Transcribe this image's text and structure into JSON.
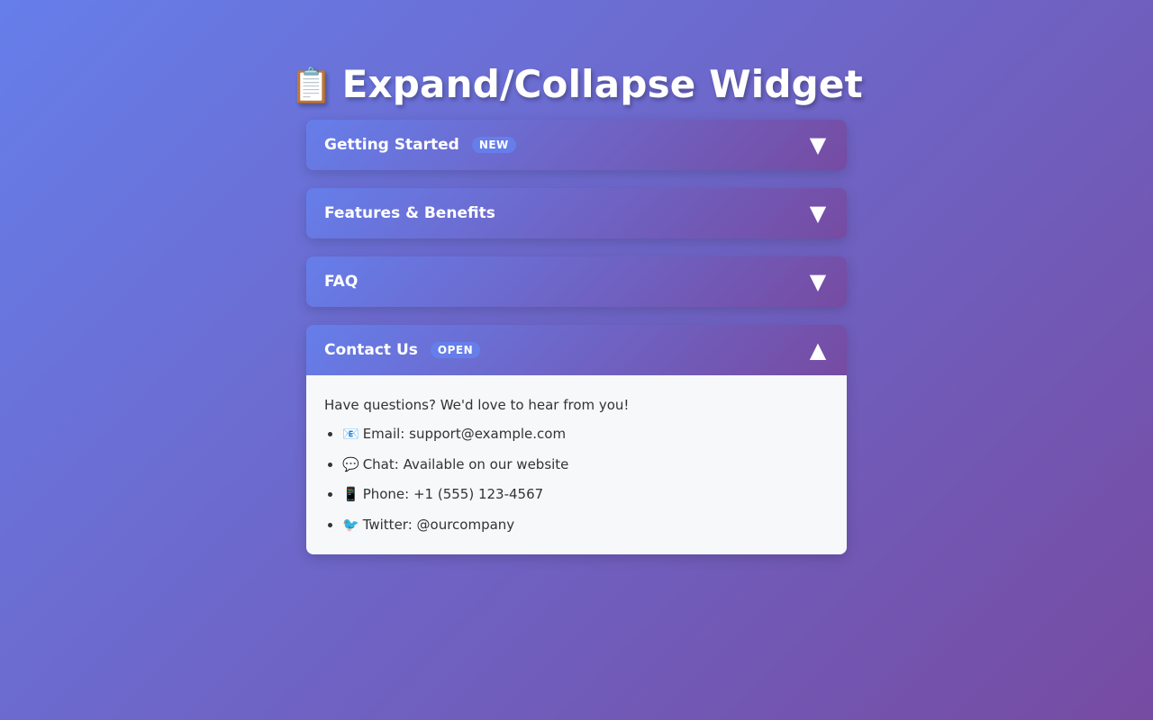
{
  "page": {
    "title_emoji": "📋",
    "title": "Expand/Collapse Widget"
  },
  "accordion": {
    "items": [
      {
        "title": "Getting Started",
        "badge": "NEW",
        "icon": "▼",
        "icon_name": "chevron-down-icon",
        "expanded": false
      },
      {
        "title": "Features & Benefits",
        "badge": "",
        "icon": "▼",
        "icon_name": "chevron-down-icon",
        "expanded": false
      },
      {
        "title": "FAQ",
        "badge": "",
        "icon": "▼",
        "icon_name": "chevron-down-icon",
        "expanded": false
      },
      {
        "title": "Contact Us",
        "badge": "OPEN",
        "icon": "▲",
        "icon_name": "chevron-up-icon",
        "expanded": true,
        "content": {
          "intro": "Have questions? We'd love to hear from you!",
          "list": [
            {
              "emoji": "📧",
              "text": "Email: support@example.com"
            },
            {
              "emoji": "💬",
              "text": "Chat: Available on our website"
            },
            {
              "emoji": "📱",
              "text": "Phone: +1 (555) 123-4567"
            },
            {
              "emoji": "🐦",
              "text": "Twitter: @ourcompany"
            }
          ]
        }
      }
    ]
  },
  "colors": {
    "gradient_start": "#667eea",
    "gradient_end": "#764ba2",
    "badge_bg": "#667eea",
    "panel_bg": "#f7f8fa",
    "body_text": "#333333"
  }
}
